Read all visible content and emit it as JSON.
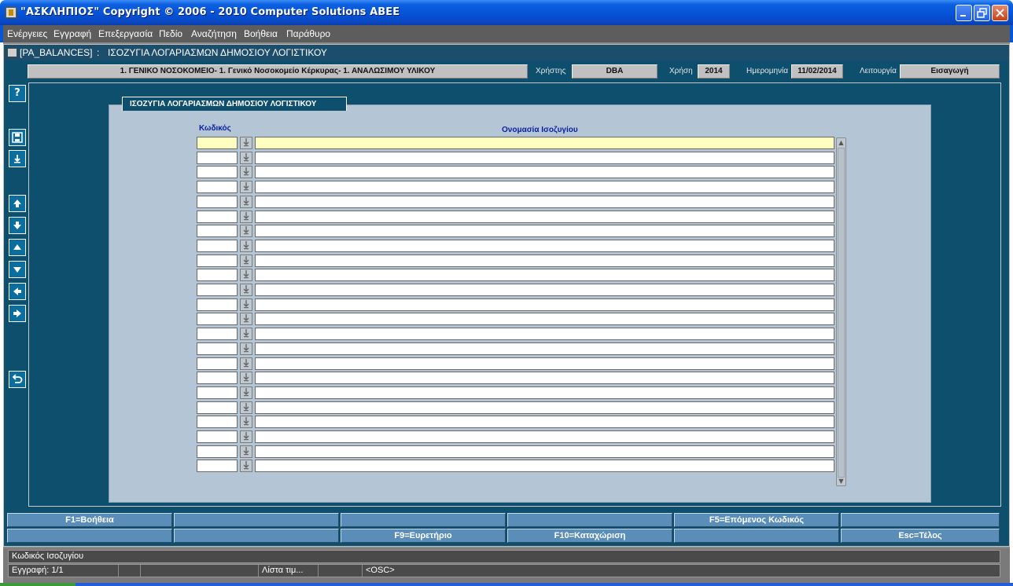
{
  "window": {
    "title": "\"ΑΣΚΛΗΠΙΟΣ\" Copyright © 2006 - 2010 Computer Solutions ΑΒΕΕ"
  },
  "menu": [
    "Ενέργειες",
    "Εγγραφή",
    "Επεξεργασία",
    "Πεδίο",
    "Αναζήτηση",
    "Βοήθεια",
    "Παράθυρο"
  ],
  "form": {
    "code": "[PA_BALANCES]",
    "separator": ":",
    "name": "ΙΣΟΖΥΓΙΑ ΛΟΓΑΡΙΑΣΜΩΝ ΔΗΜΟΣΙΟΥ ΛΟΓΙΣΤΙΚΟΥ"
  },
  "info": {
    "organization": "1. ΓΕΝΙΚΟ ΝΟΣΟΚΟΜΕΙΟ- 1. Γενικό Νοσοκομείο Κέρκυρας- 1. ΑΝΑΛΩΣΙΜΟΥ ΥΛΙΚΟΥ",
    "user_label": "Χρήστης",
    "user": "DBA",
    "year_label": "Χρήση",
    "year": "2014",
    "date_label": "Ημερομηνία",
    "date": "11/02/2014",
    "mode_label": "Λειτουργία",
    "mode": "Εισαγωγή"
  },
  "toolbar": {
    "help": "?"
  },
  "panel": {
    "title": "ΙΣΟΖΥΓΙΑ ΛΟΓΑΡΙΑΣΜΩΝ ΔΗΜΟΣΙΟΥ ΛΟΓΙΣΤΙΚΟΥ",
    "col_code": "Κωδικός",
    "col_name": "Ονομασία Ισοζυγίου"
  },
  "fkeys": {
    "row1": [
      "F1=Βοήθεια",
      "",
      "",
      "",
      "F5=Επόμενος Κωδικός",
      ""
    ],
    "row2": [
      "",
      "",
      "F9=Ευρετήριο",
      "F10=Καταχώριση",
      "",
      "Esc=Τέλος"
    ]
  },
  "status": {
    "hint": "Κωδικός Ισοζυγίου",
    "record": "Εγγραφή: 1/1",
    "cell2": "",
    "cell3": "",
    "list": "Λίστα τιμ...",
    "cell5": "",
    "osc": "<OSC>"
  }
}
